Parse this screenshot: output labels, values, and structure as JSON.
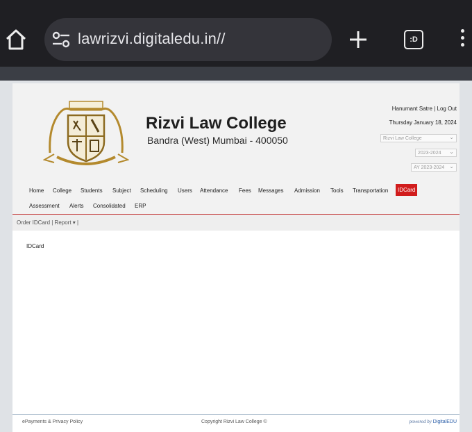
{
  "browser": {
    "url": "lawrizvi.digitaledu.in//",
    "tabs_label": ":D"
  },
  "header": {
    "college_name": "Rizvi Law College",
    "address": "Bandra (West) Mumbai - 400050",
    "user_name": "Hanumant Satre",
    "separator": " | ",
    "logout_label": "Log Out",
    "date": "Thursday January 18, 2024",
    "college_select": "Rizvi Law College",
    "year_select": "2023-2024",
    "ay_select": "AY 2023-2024"
  },
  "nav": {
    "row1": [
      "Home",
      "College",
      "Students",
      "Subject",
      "Scheduling",
      "Users",
      "Attendance",
      "Fees",
      "Messages",
      "Admission",
      "Tools",
      "Transportation",
      "IDCard"
    ],
    "row2": [
      "Assessment",
      "Alerts",
      "Consolidated",
      "ERP"
    ],
    "active": "IDCard"
  },
  "subnav": {
    "text": "Order IDCard | Report ▾ |"
  },
  "content": {
    "title": "IDCard"
  },
  "footer": {
    "left": "ePayments & Privacy Policy",
    "center": "Copyright Rizvi Law College ©",
    "powered": "powered by",
    "brand": "DigitalEDU"
  },
  "colors": {
    "chrome": "#1f1f23",
    "active_tab": "#d11c1c",
    "header_bg": "#f2f2f2"
  }
}
